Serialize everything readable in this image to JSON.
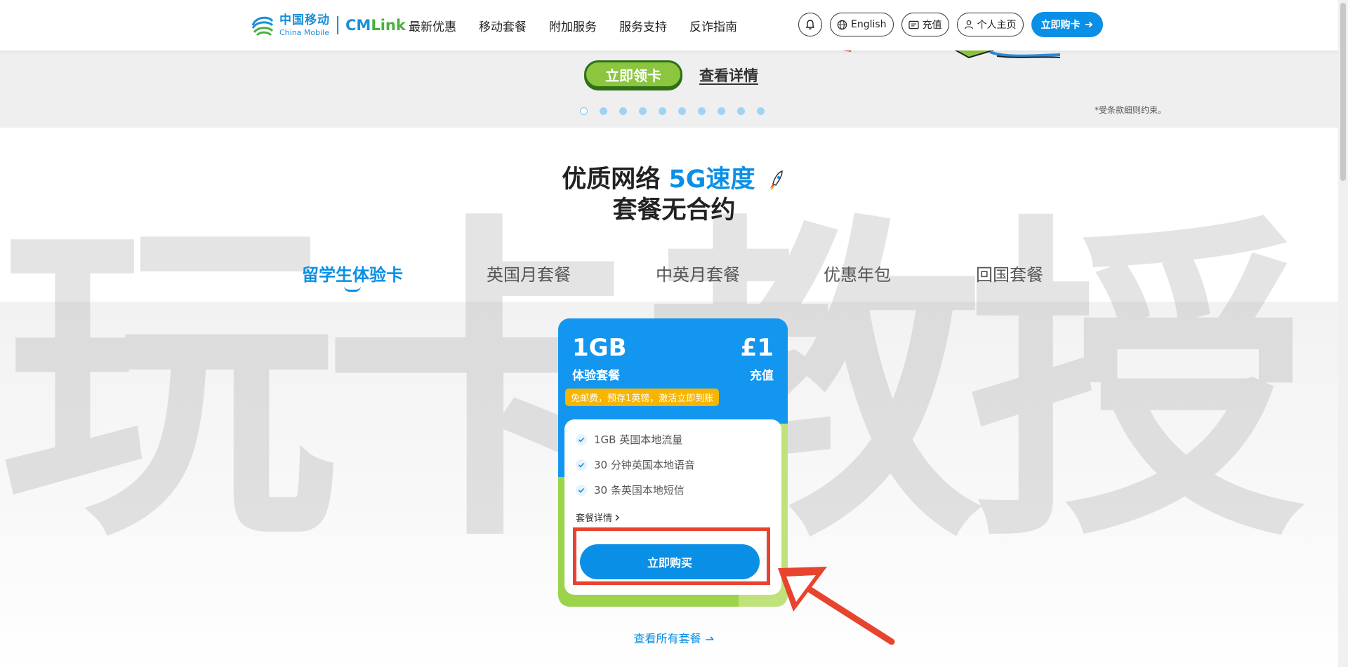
{
  "header": {
    "logo_cn": "中国移动",
    "logo_en": "China Mobile",
    "logo_brand_a": "CM",
    "logo_brand_b": "Link",
    "nav": [
      "最新优惠",
      "移动套餐",
      "附加服务",
      "服务支持",
      "反诈指南"
    ],
    "language_label": "English",
    "topup_label": "充值",
    "account_label": "个人主页",
    "cta_label": "立即购卡"
  },
  "hero": {
    "primary_button": "立即领卡",
    "secondary_button": "查看详情",
    "slide_count": 10,
    "active_slide": 1,
    "terms_note": "*受条款细则约束。"
  },
  "section": {
    "title_part1": "优质网络 ",
    "title_highlight": "5G速度",
    "title_line2": "套餐无合约",
    "tabs": [
      "留学生体验卡",
      "英国月套餐",
      "中英月套餐",
      "优惠年包",
      "回国套餐"
    ],
    "active_tab": "留学生体验卡"
  },
  "plan_card": {
    "data_amount": "1GB",
    "plan_name": "体验套餐",
    "price": "£1",
    "price_label": "充值",
    "promo_tag": "免邮费，预存1英镑，激活立即到账",
    "features": [
      "1GB 英国本地流量",
      "30 分钟英国本地语音",
      "30 条英国本地短信"
    ],
    "details_link": "套餐详情",
    "buy_button": "立即购买"
  },
  "view_all_link": "查看所有套餐",
  "watermark_text": "玩卡教授",
  "colors": {
    "brand_blue": "#0a8fe6",
    "brand_green": "#8cc63f",
    "highlight_red": "#e8432e",
    "tag_yellow": "#f7b500"
  }
}
